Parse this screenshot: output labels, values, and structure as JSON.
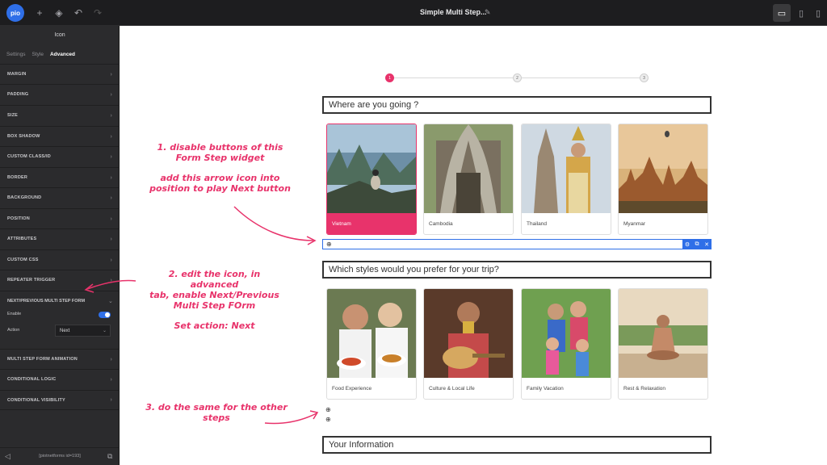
{
  "app": {
    "logo_text": "pio",
    "title": "Simple Multi Step...",
    "devices": [
      "desktop",
      "tablet",
      "mobile"
    ]
  },
  "sidebar": {
    "title": "Icon",
    "tabs": [
      "Settings",
      "Style",
      "Advanced"
    ],
    "active_tab": "Advanced",
    "sections": [
      "MARGIN",
      "PADDING",
      "SIZE",
      "BOX SHADOW",
      "CUSTOM CLASS/ID",
      "BORDER",
      "BACKGROUND",
      "POSITION",
      "ATTRIBUTES",
      "CUSTOM CSS",
      "REPEATER TRIGGER",
      "NEXT/PREVIOUS MULTI STEP FORM"
    ],
    "enable_label": "Enable",
    "enable_value": true,
    "action_label": "Action",
    "action_value": "Next",
    "sections_after": [
      "MULTI STEP FORM ANIMATION",
      "CONDITIONAL LOGIC",
      "CONDITIONAL VISIBILITY"
    ],
    "footer": "[piotnetforms id=193]"
  },
  "stepper": {
    "steps": [
      "1",
      "2",
      "3"
    ],
    "active": 1
  },
  "questions": {
    "q1": "Where are you going ?",
    "q2": "Which styles would you prefer for your trip?",
    "q3": "Your Information"
  },
  "destinations": [
    "Vietnam",
    "Cambodia",
    "Thailand",
    "Myanmar"
  ],
  "styles": [
    "Food Experience",
    "Culture & Local Life",
    "Family Vacation",
    "Rest & Relaxation"
  ],
  "annotations": {
    "note1_a": "1.     disable buttons of this",
    "note1_b": "Form Step widget",
    "note1_c": "add this arrow icon into",
    "note1_d": "position to play Next button",
    "note2_a": "2. edit the icon, in advanced",
    "note2_b": "tab, enable Next/Previous",
    "note2_c": "Multi Step FOrm",
    "note2_d": "Set action: Next",
    "note3_a": "3. do the same for the other",
    "note3_b": "steps"
  },
  "colors": {
    "accent": "#e8336b",
    "brand": "#2f6fe8",
    "sidebar": "#2b2b2d"
  }
}
